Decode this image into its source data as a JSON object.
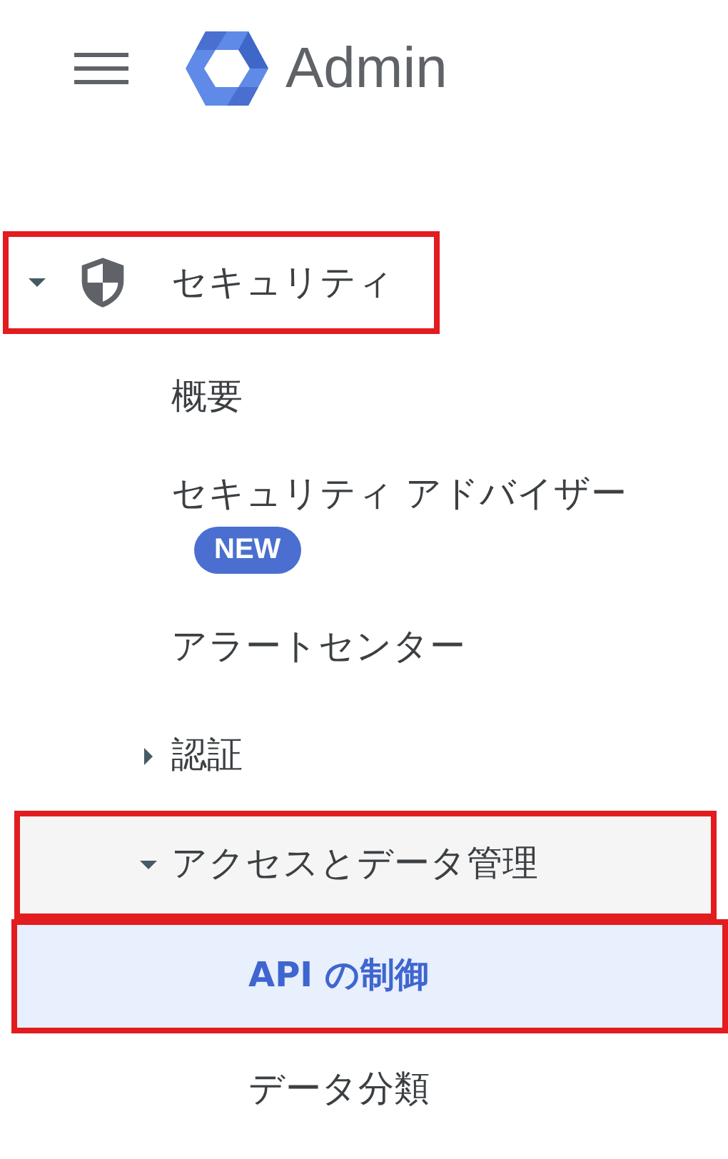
{
  "header": {
    "title": "Admin"
  },
  "nav": [
    {
      "label": "セキュリティ",
      "kind": "security",
      "expanded": true,
      "highlighted": true,
      "selected": false,
      "children": [
        {
          "label": "概要",
          "selected": false,
          "highlighted": false
        },
        {
          "label": "セキュリティ アドバイザー",
          "badge": "NEW",
          "selected": false,
          "highlighted": false
        },
        {
          "label": "アラートセンター",
          "selected": false,
          "highlighted": false
        },
        {
          "label": "認証",
          "expanded": false,
          "selected": false,
          "highlighted": false
        },
        {
          "label": "アクセスとデータ管理",
          "expanded": true,
          "hovered": true,
          "selected": false,
          "highlighted": true,
          "children": [
            {
              "label": "API の制御",
              "selected": true,
              "highlighted": true
            },
            {
              "label": "データ分類",
              "selected": false,
              "highlighted": false
            }
          ]
        }
      ]
    }
  ]
}
